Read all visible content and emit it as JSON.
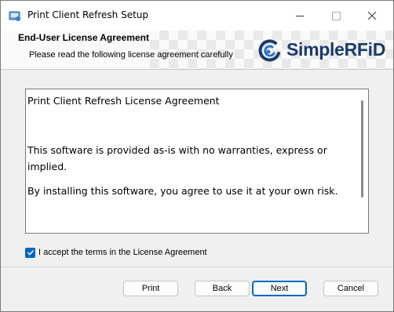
{
  "window": {
    "title": "Print Client Refresh Setup"
  },
  "banner": {
    "title": "End-User License Agreement",
    "subtitle": "Please read the following license agreement carefully",
    "logo_text": "SimpleRFiD",
    "logo_color": "#1c3a6b",
    "logo_accent_color": "#2d74c9"
  },
  "license": {
    "heading": "Print Client Refresh License Agreement",
    "paragraph1": "This software is provided as-is with no warranties, express or implied.",
    "paragraph2": "By installing this software, you agree to use it at your own risk."
  },
  "accept": {
    "checked": true,
    "label": "I accept the terms in the License Agreement"
  },
  "buttons": {
    "print": "Print",
    "back": "Back",
    "next": "Next",
    "cancel": "Cancel"
  },
  "colors": {
    "accent": "#0067c0"
  }
}
